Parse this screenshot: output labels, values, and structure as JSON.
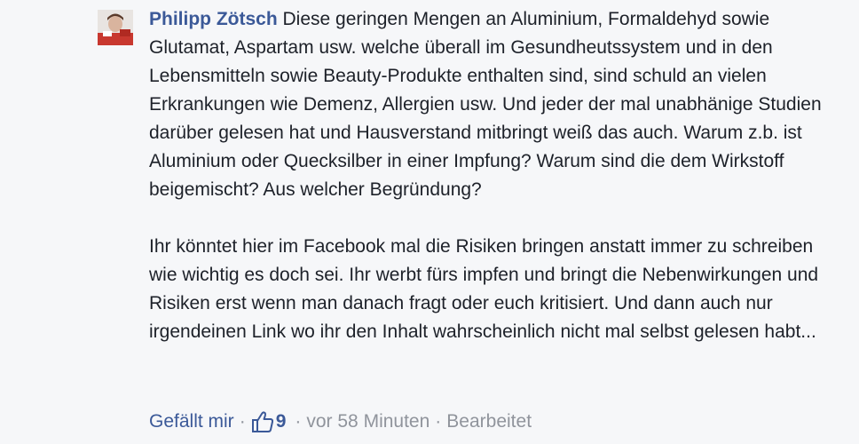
{
  "comment": {
    "author": "Philipp Zötsch",
    "paragraphs": [
      "Diese geringen Mengen an Aluminium, Formaldehyd sowie Glutamat, Aspartam usw. welche überall im Gesundheutssystem und in den Lebensmitteln sowie Beauty-Produkte enthalten sind, sind schuld an vielen Erkrankungen wie Demenz, Allergien usw. Und jeder der mal unabhänige Studien darüber gelesen hat und Hausverstand mitbringt weiß das auch. Warum z.b. ist Aluminium oder Quecksilber in einer Impfung? Warum sind die dem Wirkstoff beigemischt? Aus welcher Begründung?",
      "Ihr könntet hier im Facebook mal die Risiken bringen anstatt immer zu schreiben wie wichtig es doch sei. Ihr werbt fürs impfen und bringt die Nebenwirkungen und Risiken erst wenn man danach fragt oder euch kritisiert. Und dann auch nur irgendeinen Link wo ihr den Inhalt wahrscheinlich nicht mal selbst gelesen habt..."
    ]
  },
  "actions": {
    "like_label": "Gefällt mir",
    "separator": "·",
    "like_count": "9",
    "timestamp": "vor 58 Minuten",
    "edited_label": "Bearbeitet"
  },
  "colors": {
    "link": "#3b5998",
    "meta": "#90949c",
    "background": "#f6f7f9"
  },
  "icons": {
    "avatar": "profile-photo",
    "like": "thumbs-up-icon"
  }
}
